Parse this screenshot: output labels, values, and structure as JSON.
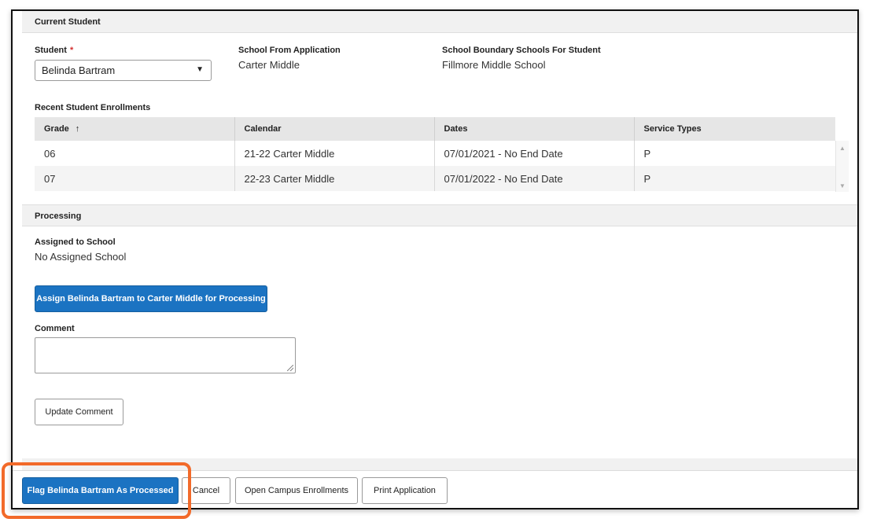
{
  "current_student": {
    "section_title": "Current Student",
    "student_label": "Student",
    "required_marker": "*",
    "student_selected": "Belinda Bartram",
    "school_from_app_label": "School From Application",
    "school_from_app_value": "Carter Middle",
    "boundary_label": "School Boundary Schools For Student",
    "boundary_value": "Fillmore Middle School"
  },
  "enrollments": {
    "title": "Recent Student Enrollments",
    "columns": [
      "Grade",
      "Calendar",
      "Dates",
      "Service Types"
    ],
    "sort_icon": "↑",
    "rows": [
      [
        "06",
        "21-22 Carter Middle",
        "07/01/2021 - No End Date",
        "P"
      ],
      [
        "07",
        "22-23 Carter Middle",
        "07/01/2022 - No End Date",
        "P"
      ]
    ]
  },
  "processing": {
    "section_title": "Processing",
    "assigned_label": "Assigned to School",
    "assigned_value": "No Assigned School",
    "assign_button": "Assign Belinda Bartram to Carter Middle for Processing",
    "comment_label": "Comment",
    "comment_value": "",
    "update_button": "Update Comment"
  },
  "footer": {
    "flag_button": "Flag Belinda Bartram As Processed",
    "cancel_button": "Cancel",
    "open_enrollments_button": "Open Campus Enrollments",
    "print_button": "Print Application"
  },
  "colors": {
    "primary": "#1b73c2",
    "highlight": "#f26a2a",
    "required": "#d32f2f"
  },
  "icons": {
    "dropdown": "caret-down-icon",
    "sort": "sort-ascending-icon"
  }
}
